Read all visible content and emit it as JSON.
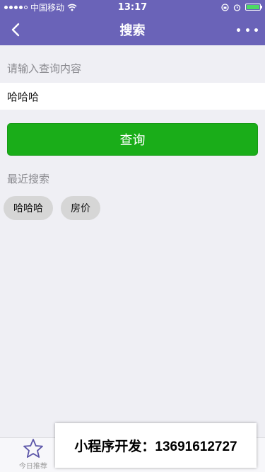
{
  "status_bar": {
    "carrier": "中国移动",
    "time": "13:17",
    "battery_level": 1.0,
    "battery_color": "#4cd964"
  },
  "nav": {
    "title": "搜索",
    "back_icon": "chevron-left-icon",
    "more_icon": "more-dots-icon",
    "background": "#6a63b8"
  },
  "search": {
    "label": "请输入查询内容",
    "value": "哈哈哈"
  },
  "query_button": {
    "label": "查询",
    "color": "#1aad19"
  },
  "recent": {
    "title": "最近搜索",
    "tags": [
      "哈哈哈",
      "房价"
    ]
  },
  "tab_bar": {
    "items": [
      {
        "label": "今日推荐",
        "icon": "star-icon"
      },
      {
        "label": "",
        "icon": ""
      },
      {
        "label": "",
        "icon": ""
      },
      {
        "label": "",
        "icon": ""
      }
    ]
  },
  "overlay": {
    "text": "小程序开发：13691612727"
  }
}
